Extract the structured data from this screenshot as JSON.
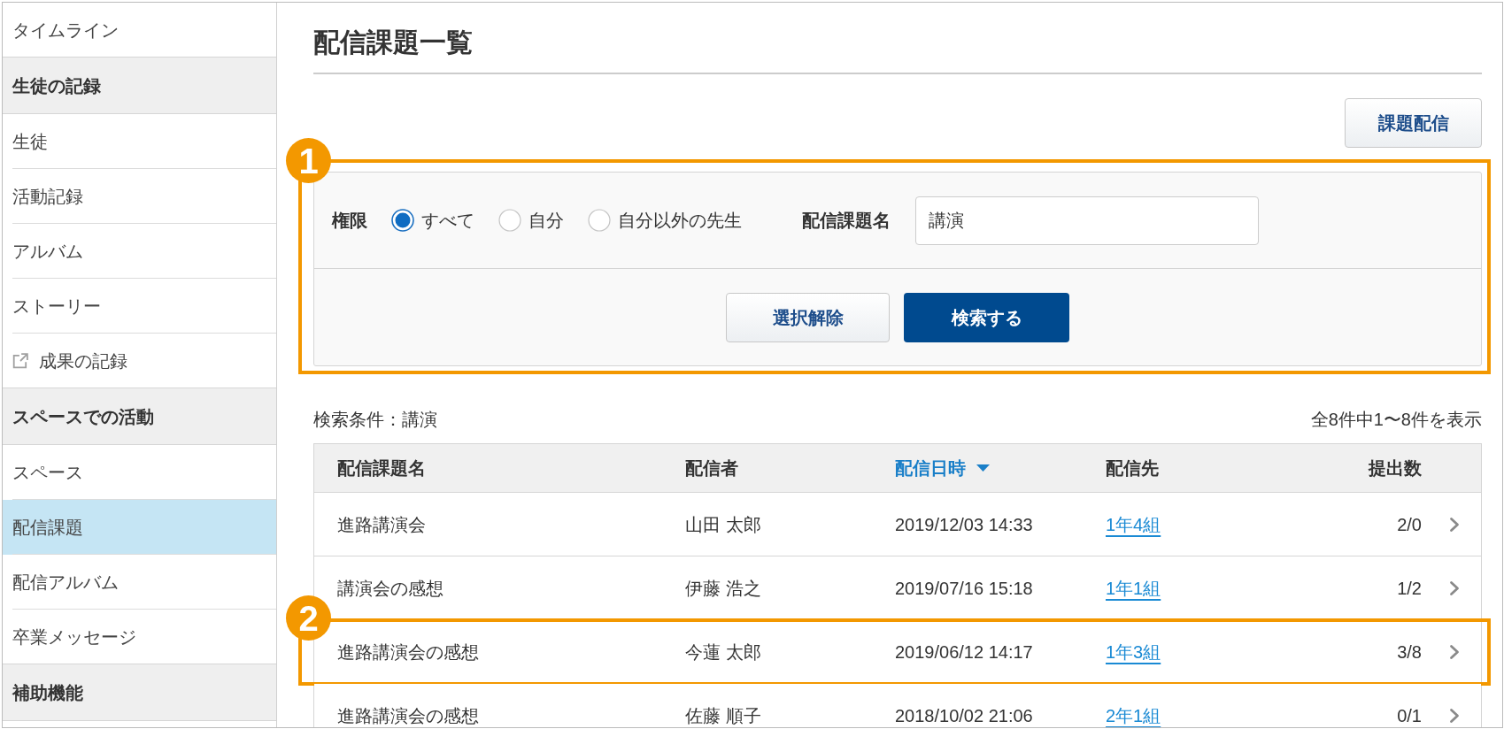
{
  "sidebar": {
    "items": [
      {
        "kind": "link",
        "label": "タイムライン",
        "selected": false,
        "external": false
      },
      {
        "kind": "header",
        "label": "生徒の記録"
      },
      {
        "kind": "link",
        "label": "生徒",
        "selected": false,
        "external": false
      },
      {
        "kind": "link",
        "label": "活動記録",
        "selected": false,
        "external": false
      },
      {
        "kind": "link",
        "label": "アルバム",
        "selected": false,
        "external": false
      },
      {
        "kind": "link",
        "label": "ストーリー",
        "selected": false,
        "external": false
      },
      {
        "kind": "link",
        "label": "成果の記録",
        "selected": false,
        "external": true
      },
      {
        "kind": "header",
        "label": "スペースでの活動"
      },
      {
        "kind": "link",
        "label": "スペース",
        "selected": false,
        "external": false
      },
      {
        "kind": "link",
        "label": "配信課題",
        "selected": true,
        "external": false
      },
      {
        "kind": "link",
        "label": "配信アルバム",
        "selected": false,
        "external": false
      },
      {
        "kind": "link",
        "label": "卒業メッセージ",
        "selected": false,
        "external": false
      },
      {
        "kind": "header",
        "label": "補助機能"
      }
    ]
  },
  "page": {
    "title": "配信課題一覧",
    "action_button": "課題配信"
  },
  "filter": {
    "callout": "1",
    "permission_label": "権限",
    "permission_options": [
      {
        "label": "すべて",
        "selected": true
      },
      {
        "label": "自分",
        "selected": false
      },
      {
        "label": "自分以外の先生",
        "selected": false
      }
    ],
    "name_label": "配信課題名",
    "name_value": "講演",
    "clear_button": "選択解除",
    "search_button": "検索する"
  },
  "results": {
    "condition": "検索条件：講演",
    "count": "全8件中1〜8件を表示"
  },
  "table": {
    "columns": [
      {
        "label": "配信課題名",
        "sorted": false
      },
      {
        "label": "配信者",
        "sorted": false
      },
      {
        "label": "配信日時",
        "sorted": true
      },
      {
        "label": "配信先",
        "sorted": false
      },
      {
        "label": "提出数",
        "sorted": false
      }
    ],
    "rows": [
      {
        "title": "進路講演会",
        "sender": "山田 太郎",
        "date": "2019/12/03 14:33",
        "recipient": "1年4組",
        "submissions": "2/0"
      },
      {
        "title": "講演会の感想",
        "sender": "伊藤 浩之",
        "date": "2019/07/16 15:18",
        "recipient": "1年1組",
        "submissions": "1/2"
      },
      {
        "title": "進路講演会の感想",
        "sender": "今蓮 太郎",
        "date": "2019/06/12 14:17",
        "recipient": "1年3組",
        "submissions": "3/8",
        "callout": "2"
      },
      {
        "title": "進路講演会の感想",
        "sender": "佐藤 順子",
        "date": "2018/10/02 21:06",
        "recipient": "2年1組",
        "submissions": "0/1"
      }
    ]
  }
}
